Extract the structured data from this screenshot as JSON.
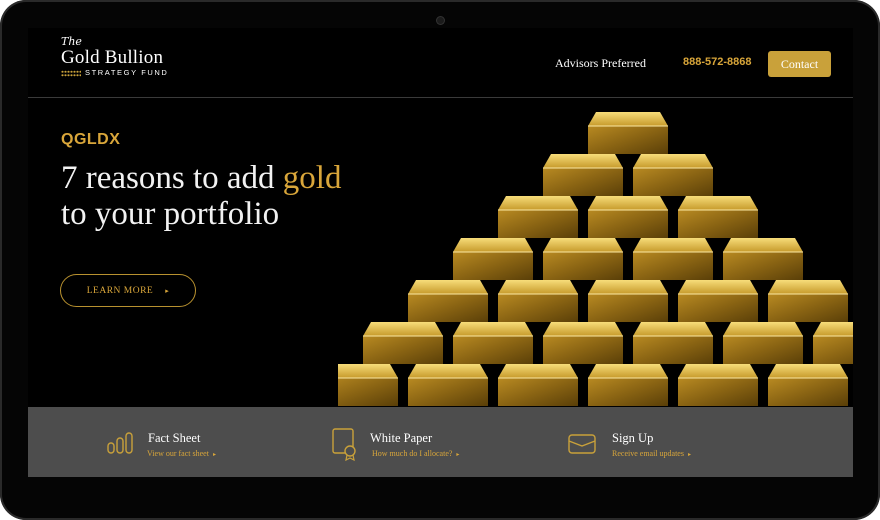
{
  "header": {
    "logo": {
      "the": "The",
      "main": "Gold Bullion",
      "sub": "STRATEGY FUND"
    },
    "nav_advisors": "Advisors Preferred",
    "nav_phone": "888-572-8868",
    "contact_label": "Contact"
  },
  "hero": {
    "ticker": "QGLDX",
    "headline_line1_part1": "7 reasons to add ",
    "headline_line1_gold": "gold",
    "headline_line2": "to your portfolio",
    "learn_more_label": "LEARN MORE",
    "learn_more_chevron": "▸"
  },
  "cards": [
    {
      "icon": "bar-chart-icon",
      "title": "Fact Sheet",
      "link": "View our fact sheet",
      "chevron": "▸"
    },
    {
      "icon": "certificate-icon",
      "title": "White Paper",
      "link": "How much do I allocate?",
      "chevron": "▸"
    },
    {
      "icon": "envelope-icon",
      "title": "Sign Up",
      "link": "Receive email updates",
      "chevron": "▸"
    }
  ],
  "colors": {
    "accent": "#d9a63a",
    "button": "#c9a13a",
    "panel": "#4d4d4d",
    "background": "#000000"
  }
}
